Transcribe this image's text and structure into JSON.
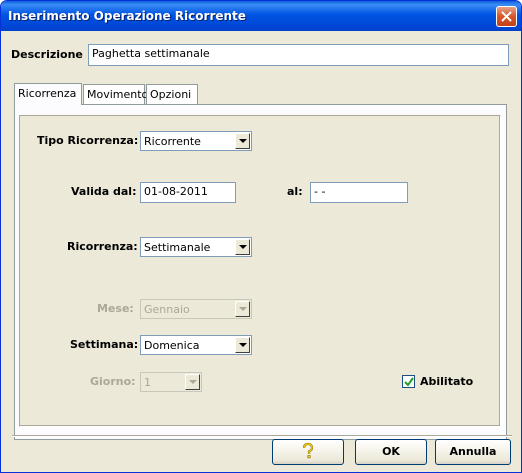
{
  "window": {
    "title": "Inserimento Operazione Ricorrente",
    "close_icon": "close-icon"
  },
  "descrizione": {
    "label": "Descrizione",
    "value": "Paghetta settimanale"
  },
  "tabs": [
    {
      "label": "Ricorrenza",
      "active": true
    },
    {
      "label": "Movimento",
      "active": false
    },
    {
      "label": "Opzioni",
      "active": false
    }
  ],
  "form": {
    "tipo_ricorrenza": {
      "label": "Tipo Ricorrenza:",
      "value": "Ricorrente",
      "enabled": true
    },
    "valida_dal": {
      "label": "Valida dal:",
      "value": "01-08-2011"
    },
    "al": {
      "label": "al:",
      "value": " - -"
    },
    "ricorrenza": {
      "label": "Ricorrenza:",
      "value": "Settimanale",
      "enabled": true
    },
    "mese": {
      "label": "Mese:",
      "value": "Gennaio",
      "enabled": false
    },
    "settimana": {
      "label": "Settimana:",
      "value": "Domenica",
      "enabled": true
    },
    "giorno": {
      "label": "Giorno:",
      "value": "1",
      "enabled": false
    },
    "abilitato": {
      "label": "Abilitato",
      "checked": true
    }
  },
  "buttons": {
    "help_icon": "help-icon",
    "ok_label": "OK",
    "cancel_label": "Annulla"
  },
  "colors": {
    "title_bar": "#0054e3",
    "window_bg": "#ece9d8",
    "disabled_text": "#aca899"
  }
}
